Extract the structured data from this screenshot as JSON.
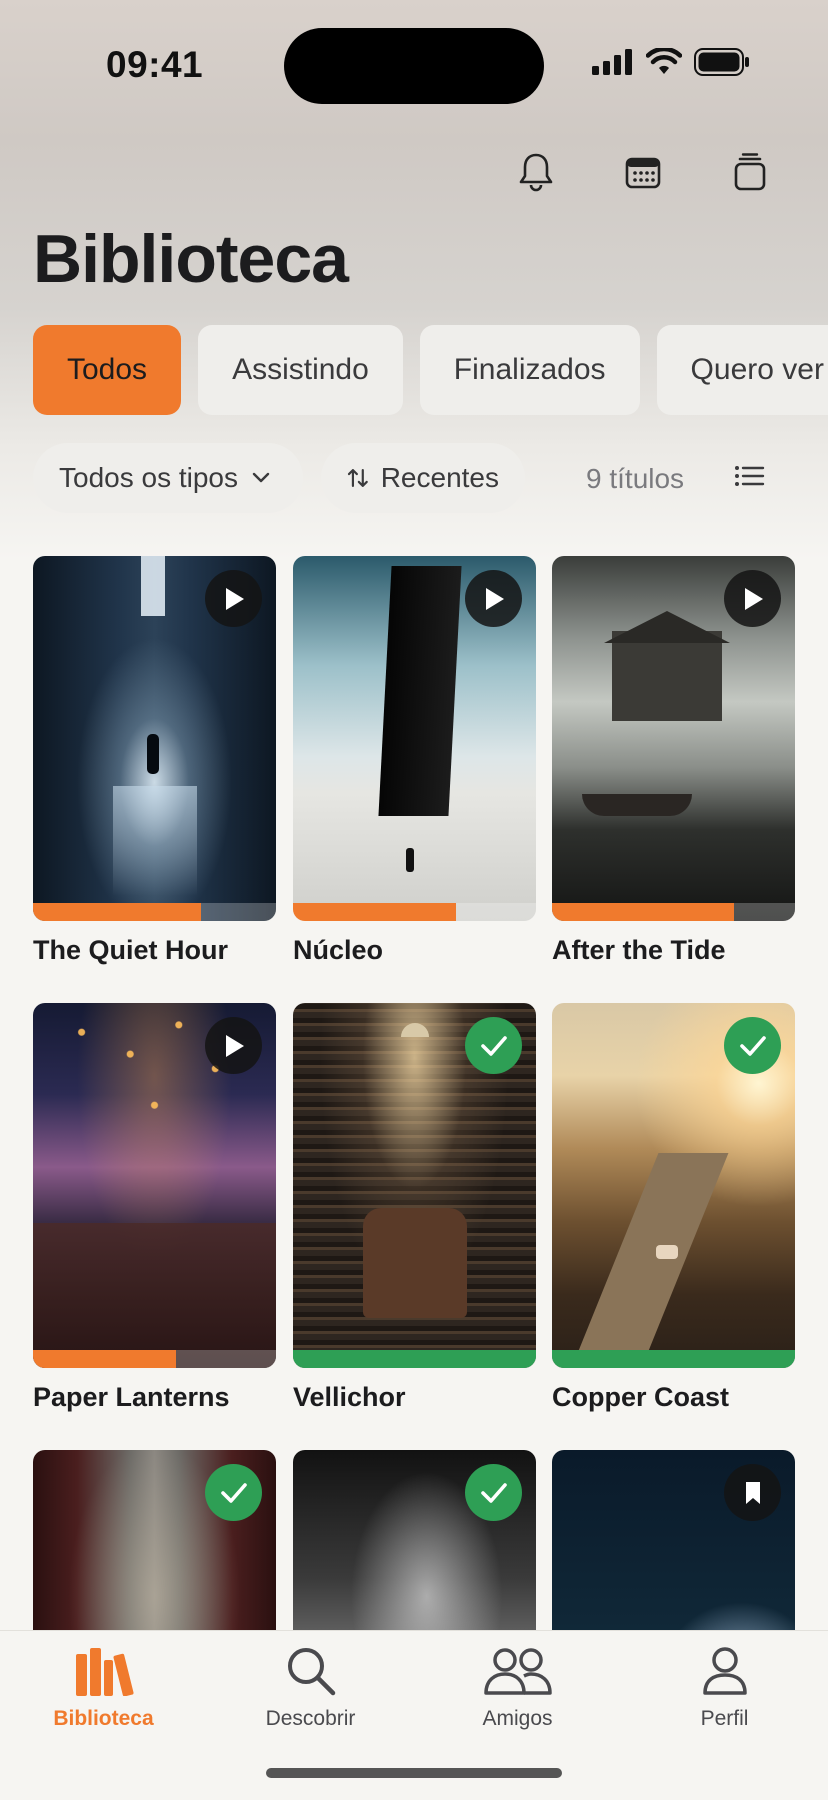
{
  "status_bar": {
    "time": "09:41"
  },
  "top_actions": [
    {
      "icon": "bell-icon"
    },
    {
      "icon": "calendar-icon"
    },
    {
      "icon": "stack-icon"
    }
  ],
  "title": "Biblioteca",
  "tabs": [
    {
      "label": "Todos",
      "active": true
    },
    {
      "label": "Assistindo",
      "active": false
    },
    {
      "label": "Finalizados",
      "active": false
    },
    {
      "label": "Quero ver",
      "active": false
    }
  ],
  "filters": {
    "type_label": "Todos os tipos",
    "sort_label": "Recentes",
    "count_label": "9 títulos"
  },
  "items": [
    {
      "title": "The Quiet Hour",
      "status": "playing",
      "progress": 0.69
    },
    {
      "title": "Núcleo",
      "status": "playing",
      "progress": 0.67
    },
    {
      "title": "After the Tide",
      "status": "playing",
      "progress": 0.75
    },
    {
      "title": "Paper Lanterns",
      "status": "playing",
      "progress": 0.59
    },
    {
      "title": "Vellichor",
      "status": "finished",
      "progress": 1.0
    },
    {
      "title": "Copper Coast",
      "status": "finished",
      "progress": 1.0
    },
    {
      "title": "",
      "status": "finished",
      "progress": 0
    },
    {
      "title": "",
      "status": "finished",
      "progress": 0
    },
    {
      "title": "",
      "status": "bookmarked",
      "progress": 0
    }
  ],
  "colors": {
    "accent": "#f07a2d",
    "finished": "#2e9f55"
  },
  "tabbar": [
    {
      "label": "Biblioteca",
      "icon": "library-icon",
      "active": true
    },
    {
      "label": "Descobrir",
      "icon": "search-icon",
      "active": false
    },
    {
      "label": "Amigos",
      "icon": "friends-icon",
      "active": false
    },
    {
      "label": "Perfil",
      "icon": "profile-icon",
      "active": false
    }
  ]
}
